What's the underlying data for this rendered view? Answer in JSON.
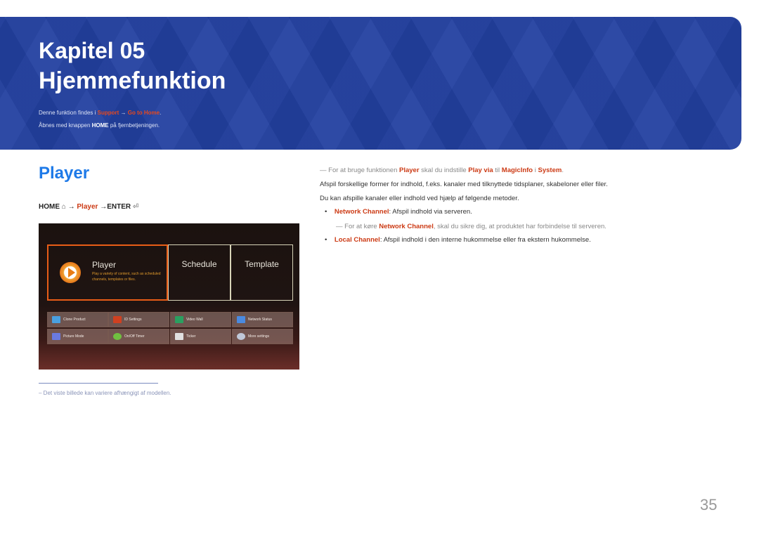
{
  "banner": {
    "chapter": "Kapitel 05",
    "title": "Hjemmefunktion",
    "line1_prefix": "Denne funktion findes i ",
    "line1_link1": "Support",
    "line1_arrow": " → ",
    "line1_link2": "Go to Home",
    "line1_suffix": ".",
    "line2_prefix": "Åbnes med knappen ",
    "line2_bold": "HOME",
    "line2_suffix": " på fjernbetjeningen."
  },
  "section": {
    "title": "Player",
    "path_home": "HOME",
    "path_home_icon": "⌂",
    "path_arrow1": " → ",
    "path_player": "Player",
    "path_arrow2": " →",
    "path_enter": "ENTER",
    "path_enter_icon": "⏎"
  },
  "screen": {
    "tiles": {
      "player": "Player",
      "player_desc": "Play a variety of content, such as scheduled channels, templates or files.",
      "schedule": "Schedule",
      "template": "Template"
    },
    "grid": [
      {
        "label": "Clone Product",
        "icon": "clone-icon",
        "color": "#4aa0e0"
      },
      {
        "label": "ID Settings",
        "icon": "id-icon",
        "color": "#d04020"
      },
      {
        "label": "Video Wall",
        "icon": "video-wall-icon",
        "color": "#2aa060"
      },
      {
        "label": "Network Status",
        "icon": "network-icon",
        "color": "#4a8ae0"
      },
      {
        "label": "Picture Mode",
        "icon": "picture-mode-icon",
        "color": "#6a7ae0"
      },
      {
        "label": "On/Off Timer",
        "icon": "timer-icon",
        "color": "#70c040"
      },
      {
        "label": "Ticker",
        "icon": "ticker-icon",
        "color": "#e0e0e0"
      },
      {
        "label": "More settings",
        "icon": "gear-icon",
        "color": "#c0c8d8"
      }
    ]
  },
  "footnote": "Det viste billede kan variere afhængigt af modellen.",
  "right": {
    "note1": {
      "p1": "For at bruge funktionen ",
      "b1": "Player",
      "p2": " skal du indstille ",
      "b2": "Play via",
      "p3": " til ",
      "b3": "MagicInfo",
      "p4": " i ",
      "b4": "System",
      "p5": "."
    },
    "para1": "Afspil forskellige former for indhold, f.eks. kanaler med tilknyttede tidsplaner, skabeloner eller filer.",
    "para2": "Du kan afspille kanaler eller indhold ved hjælp af følgende metoder.",
    "bullet1": {
      "b": "Network Channel",
      "t": ": Afspil indhold via serveren."
    },
    "note2": {
      "p1": "For at køre ",
      "b": "Network Channel",
      "p2": ", skal du sikre dig, at produktet har forbindelse til serveren."
    },
    "bullet2": {
      "b": "Local Channel",
      "t": ": Afspil indhold i den interne hukommelse eller fra ekstern hukommelse."
    }
  },
  "page_number": "35"
}
